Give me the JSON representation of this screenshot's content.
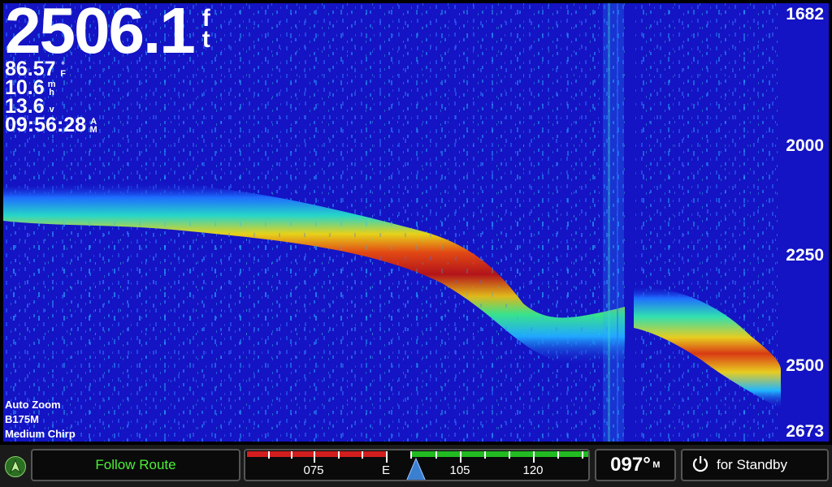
{
  "readouts": {
    "depth": "2506.1",
    "depth_unit": [
      "f",
      "t"
    ],
    "water_temp": "86.57",
    "water_temp_unit": [
      "°",
      "F"
    ],
    "speed": "10.6",
    "speed_unit": [
      "m",
      "h"
    ],
    "voltage": "13.6",
    "voltage_unit": "v",
    "time": "09:56:28",
    "time_unit": [
      "A",
      "M"
    ]
  },
  "depth_scale": {
    "labels": [
      "1682",
      "2000",
      "2250",
      "2500",
      "2673"
    ]
  },
  "sonar_info": {
    "zoom": "Auto Zoom",
    "transducer": "B175M",
    "mode": "Medium Chirp"
  },
  "bottom_bar": {
    "follow_route_label": "Follow Route",
    "compass_labels": [
      "075",
      "E",
      "105",
      "120"
    ],
    "heading_value": "097°",
    "heading_unit": "M",
    "standby_label": "for Standby"
  },
  "colors": {
    "sonar_background": "#1414c4",
    "follow_route_text": "#4bef36",
    "port_red": "#d21e1e",
    "starboard_green": "#22bb22",
    "compass_pointer": "#3b7fd1"
  },
  "icons": {
    "nav": "navigation-arrow-icon",
    "standby": "power-icon",
    "compass_pointer": "heading-pointer-icon"
  }
}
